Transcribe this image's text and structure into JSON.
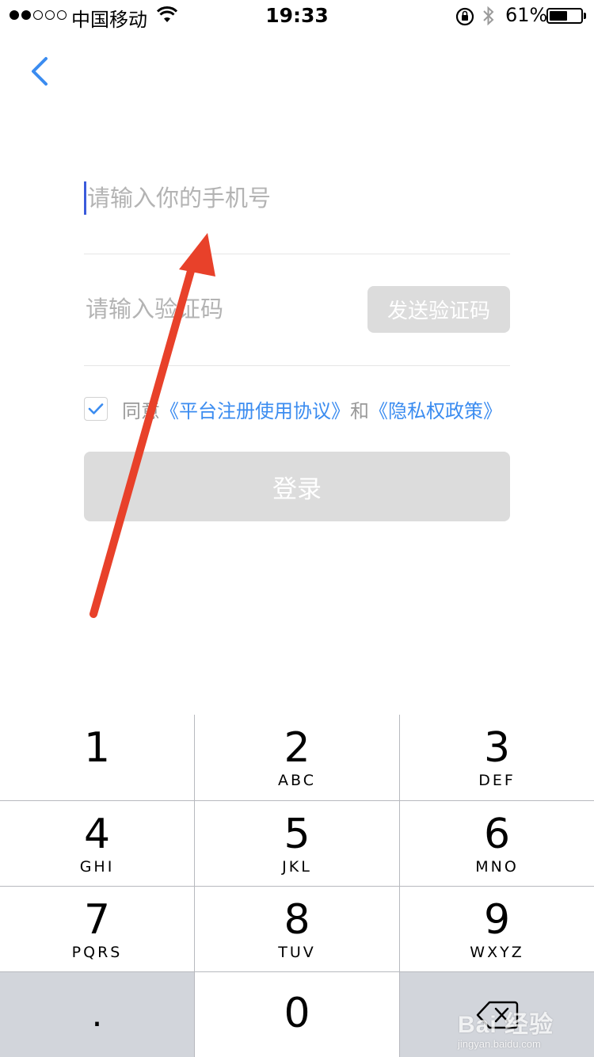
{
  "status_bar": {
    "carrier": "中国移动",
    "time": "19:33",
    "battery_percent": "61%",
    "battery_level": 0.61,
    "signal_bars_filled": 2,
    "signal_bars_total": 5,
    "icons": [
      "wifi-icon",
      "rotation-lock-icon",
      "bluetooth-icon",
      "battery-icon"
    ]
  },
  "nav": {
    "back_icon": "chevron-left-icon",
    "accent": "#3b8cf0"
  },
  "form": {
    "phone_placeholder": "请输入你的手机号",
    "phone_value": "",
    "code_placeholder": "请输入验证码",
    "code_value": "",
    "send_code_label": "发送验证码",
    "agree_checked": true,
    "agree_prefix": "同意",
    "agreement_link": "《平台注册使用协议》",
    "agree_and": "和",
    "privacy_link": "《隐私权政策》",
    "login_label": "登录",
    "disabled_color": "#dcdcdc",
    "caret_color": "#3b5bdb"
  },
  "annotation": {
    "type": "arrow",
    "color": "#e8412a"
  },
  "keypad": {
    "keys": [
      {
        "num": "1",
        "letters": ""
      },
      {
        "num": "2",
        "letters": "ABC"
      },
      {
        "num": "3",
        "letters": "DEF"
      },
      {
        "num": "4",
        "letters": "GHI"
      },
      {
        "num": "5",
        "letters": "JKL"
      },
      {
        "num": "6",
        "letters": "MNO"
      },
      {
        "num": "7",
        "letters": "PQRS"
      },
      {
        "num": "8",
        "letters": "TUV"
      },
      {
        "num": "9",
        "letters": "WXYZ"
      }
    ],
    "dot_key": ".",
    "zero_key": "0",
    "delete_icon": "backspace-icon"
  },
  "watermark": {
    "logo": "Bai 经验",
    "url": "jingyan.baidu.com"
  }
}
